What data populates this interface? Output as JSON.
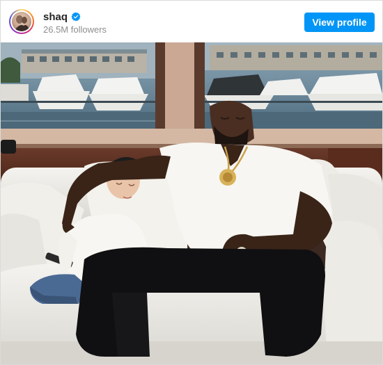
{
  "post": {
    "username": "shaq",
    "followers": "26.5M followers",
    "view_profile_label": "View profile",
    "verified": true,
    "avatar_icon": "profile-avatar-icon",
    "verified_icon": "verified-badge-icon"
  },
  "colors": {
    "accent": "#0095f6",
    "username_text": "#262626",
    "secondary_text": "#8e8e8e",
    "verified_badge": "#0095f6"
  }
}
